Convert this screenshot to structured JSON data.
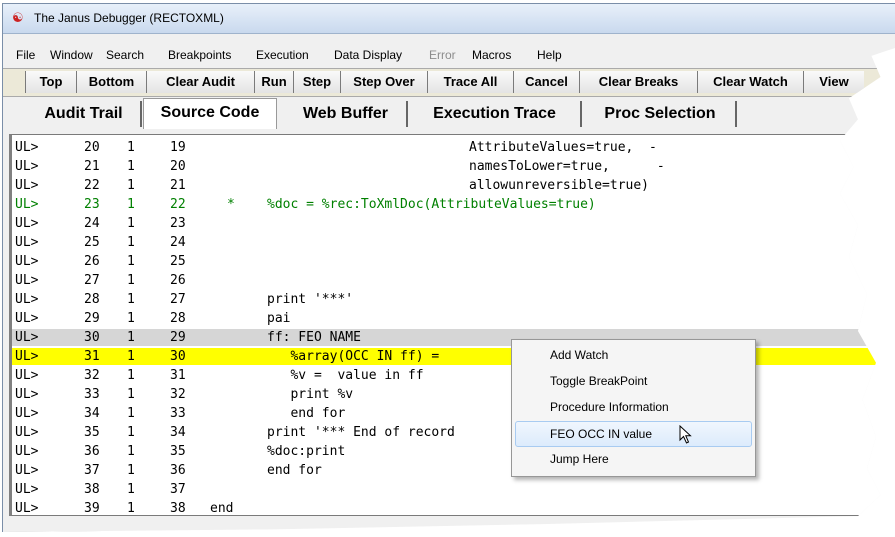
{
  "window": {
    "title": "The Janus Debugger (RECTOXML)",
    "icon": "janus-app-icon"
  },
  "menu": [
    "File",
    "Window",
    "Search",
    "Breakpoints",
    "Execution",
    "Data Display",
    "Error",
    "Macros",
    "Help"
  ],
  "menu_disabled": [
    "Error"
  ],
  "toolbar": [
    "Top",
    "Bottom",
    "Clear Audit",
    "Run",
    "Step",
    "Step Over",
    "Trace All",
    "Cancel",
    "Clear Breaks",
    "Clear Watch",
    "View"
  ],
  "tabs": [
    "Audit Trail",
    "Source Code",
    "Web Buffer",
    "Execution Trace",
    "Proc Selection"
  ],
  "active_tab": "Source Code",
  "code_lines": [
    {
      "prefix": "UL>",
      "a": "20",
      "b": "1",
      "c": "19",
      "mark": "",
      "text": "AttributeValues=true,  -"
    },
    {
      "prefix": "UL>",
      "a": "21",
      "b": "1",
      "c": "20",
      "mark": "",
      "text": "namesToLower=true,      -"
    },
    {
      "prefix": "UL>",
      "a": "22",
      "b": "1",
      "c": "21",
      "mark": "",
      "text": "allowunreversible=true)"
    },
    {
      "prefix": "UL>",
      "a": "23",
      "b": "1",
      "c": "22",
      "mark": "*",
      "text": "%doc = %rec:ToXmlDoc(AttributeValues=true)"
    },
    {
      "prefix": "UL>",
      "a": "24",
      "b": "1",
      "c": "23",
      "mark": "",
      "text": ""
    },
    {
      "prefix": "UL>",
      "a": "25",
      "b": "1",
      "c": "24",
      "mark": "",
      "text": ""
    },
    {
      "prefix": "UL>",
      "a": "26",
      "b": "1",
      "c": "25",
      "mark": "",
      "text": ""
    },
    {
      "prefix": "UL>",
      "a": "27",
      "b": "1",
      "c": "26",
      "mark": "",
      "text": ""
    },
    {
      "prefix": "UL>",
      "a": "28",
      "b": "1",
      "c": "27",
      "mark": "",
      "text": "print '***'"
    },
    {
      "prefix": "UL>",
      "a": "29",
      "b": "1",
      "c": "28",
      "mark": "",
      "text": "pai"
    },
    {
      "prefix": "UL>",
      "a": "30",
      "b": "1",
      "c": "29",
      "mark": "",
      "text": "ff: FEO NAME"
    },
    {
      "prefix": "UL>",
      "a": "31",
      "b": "1",
      "c": "30",
      "mark": "",
      "text": "   %array(OCC IN ff) ="
    },
    {
      "prefix": "UL>",
      "a": "32",
      "b": "1",
      "c": "31",
      "mark": "",
      "text": "   %v =  value in ff"
    },
    {
      "prefix": "UL>",
      "a": "33",
      "b": "1",
      "c": "32",
      "mark": "",
      "text": "   print %v"
    },
    {
      "prefix": "UL>",
      "a": "34",
      "b": "1",
      "c": "33",
      "mark": "",
      "text": "   end for"
    },
    {
      "prefix": "UL>",
      "a": "35",
      "b": "1",
      "c": "34",
      "mark": "",
      "text": "print '*** End of record"
    },
    {
      "prefix": "UL>",
      "a": "36",
      "b": "1",
      "c": "35",
      "mark": "",
      "text": "%doc:print"
    },
    {
      "prefix": "UL>",
      "a": "37",
      "b": "1",
      "c": "36",
      "mark": "",
      "text": "end for"
    },
    {
      "prefix": "UL>",
      "a": "38",
      "b": "1",
      "c": "37",
      "mark": "",
      "text": ""
    },
    {
      "prefix": "UL>",
      "a": "39",
      "b": "1",
      "c": "38",
      "mark": "",
      "text": "end"
    }
  ],
  "highlight": {
    "gray_line": "30",
    "yellow_line": "31",
    "green_line": "23"
  },
  "context_menu": {
    "items": [
      "Add Watch",
      "Toggle BreakPoint",
      "Procedure Information",
      "FEO OCC IN value",
      "Jump Here"
    ],
    "hovered": "FEO OCC IN value"
  },
  "colors": {
    "current_line": "#ffff00",
    "selected_line": "#d6d6d6",
    "comment_green": "#008000",
    "app_icon": "#cc2222"
  }
}
